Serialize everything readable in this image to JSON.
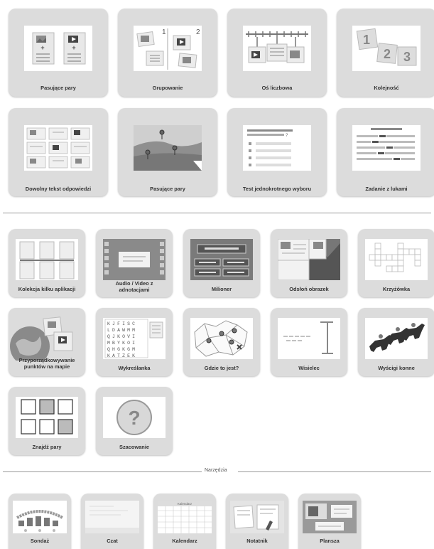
{
  "row1": [
    "Pasujące pary",
    "Grupowanie",
    "Oś liczbowa",
    "Kolejność"
  ],
  "row2": [
    "Dowolny tekst odpowiedzi",
    "Pasujące pary",
    "Test jednokrotnego wyboru",
    "Zadanie z lukami"
  ],
  "row3": [
    "Kolekcja kilku aplikacji",
    "Audio / Video z adnotacjami",
    "Milioner",
    "Odsłoń obrazek",
    "Krzyżówka"
  ],
  "row4": [
    "Przyporządkowywanie punktów na mapie",
    "Wykreślanka",
    "Gdzie to jest?",
    "Wisielec",
    "Wyścigi konne"
  ],
  "row5": [
    "Znajdź pary",
    "Szacowanie"
  ],
  "tools_header": "Narzędzia",
  "tools": [
    "Sondaż",
    "Czat",
    "Kalendarz",
    "Notatnik",
    "Plansza"
  ],
  "grouping_numbers": [
    "1",
    "2"
  ],
  "order_numbers": [
    "1",
    "2",
    "3"
  ],
  "wordsearch_rows": [
    "KJFISC",
    "LDAWMM",
    "QJKOVI",
    "MBYKOI",
    "QHGKGM",
    "KATZEK"
  ],
  "calendar_title": "Kalendarz"
}
